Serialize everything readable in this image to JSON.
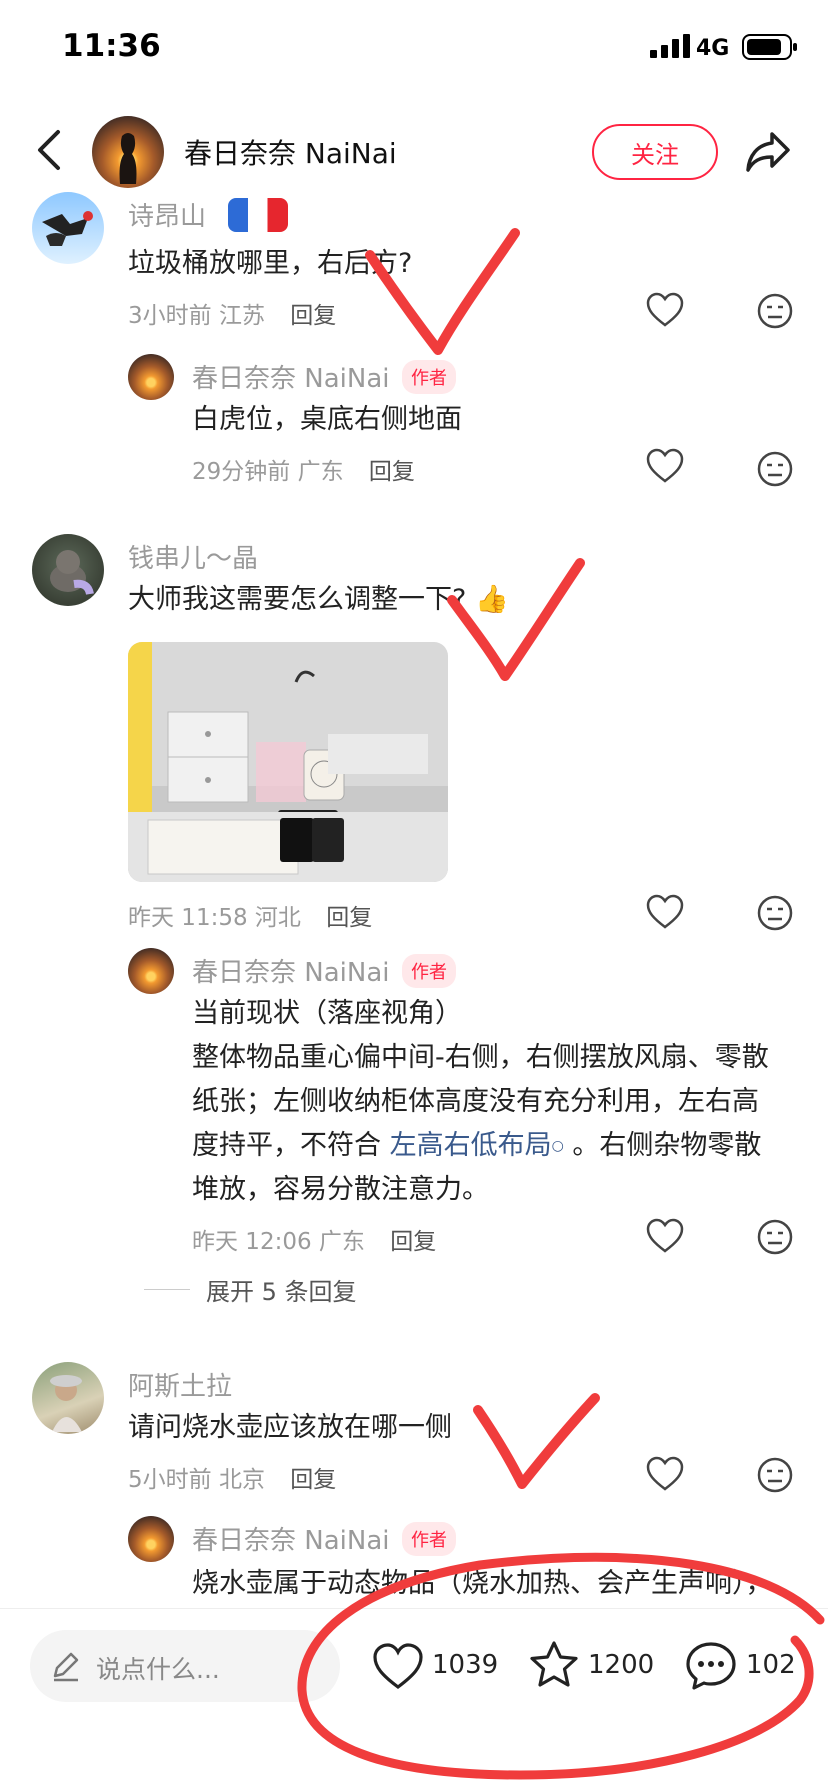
{
  "status_bar": {
    "time": "11:36",
    "network": "4G"
  },
  "header": {
    "author_name": "春日奈奈 NaiNai",
    "follow_label": "关注"
  },
  "comments": [
    {
      "user": "诗昂山",
      "text": "垃圾桶放哪里，右后方?",
      "time": "3小时前",
      "location": "江苏",
      "reply_label": "回复",
      "author_reply": {
        "user": "春日奈奈 NaiNai",
        "badge": "作者",
        "text": "白虎位，桌底右侧地面",
        "time": "29分钟前",
        "location": "广东",
        "reply_label": "回复"
      }
    },
    {
      "user": "钱串儿～晶",
      "text": "大师我这需要怎么调整一下?",
      "emoji": "👍",
      "time": "昨天 11:58",
      "location": "河北",
      "reply_label": "回复",
      "author_reply": {
        "user": "春日奈奈 NaiNai",
        "badge": "作者",
        "line1": "当前现状（落座视角）",
        "line2": "整体物品重心偏中间-右侧，右侧摆放风扇、零散",
        "line3": "纸张；左侧收纳柜体高度没有充分利用，左右高",
        "line4_pre": "度持平，不符合",
        "line4_link": "左高右低布局",
        "line4_post": "。右侧杂物零散",
        "line5": "堆放，容易分散注意力。",
        "time": "昨天 12:06",
        "location": "广东",
        "reply_label": "回复"
      },
      "expand_label": "展开 5 条回复"
    },
    {
      "user": "阿斯土拉",
      "text": "请问烧水壶应该放在哪一侧",
      "time": "5小时前",
      "location": "北京",
      "reply_label": "回复",
      "author_reply": {
        "user": "春日奈奈 NaiNai",
        "badge": "作者",
        "text": "烧水壶属于动态物品（烧水加热、会产生声响），"
      }
    }
  ],
  "bottom_bar": {
    "input_placeholder": "说点什么...",
    "likes": "1039",
    "collects": "1200",
    "comments": "102"
  },
  "colors": {
    "accent": "#ff2442",
    "annotation": "#f03c3c",
    "link": "#3a5a8c"
  }
}
